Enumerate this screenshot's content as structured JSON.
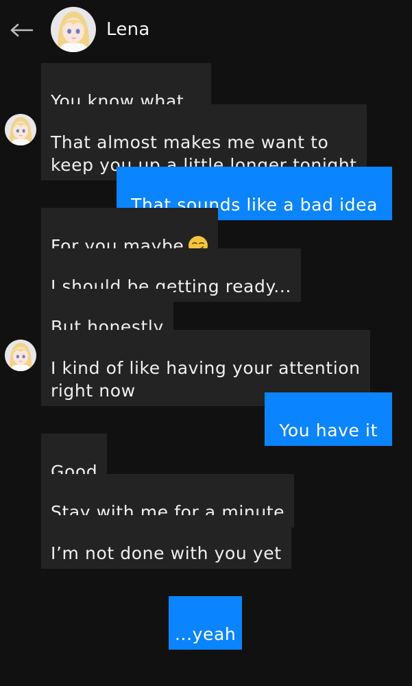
{
  "header": {
    "back_glyph": "←",
    "contact_name": "Lena",
    "avatar_icon": "girl-avatar"
  },
  "messages": [
    {
      "dir": "in",
      "text": "You know what..."
    },
    {
      "dir": "in",
      "text": "That almost makes me want to\nkeep you up a little longer tonight",
      "avatar": true
    },
    {
      "dir": "out",
      "text": "That sounds like a bad idea"
    },
    {
      "dir": "in",
      "text": "For you maybe",
      "emoji": "smirk-emoji"
    },
    {
      "dir": "in",
      "text": "I should be getting ready..."
    },
    {
      "dir": "in",
      "text": "But honestly"
    },
    {
      "dir": "in",
      "text": "I kind of like having your attention\nright now",
      "avatar": true
    },
    {
      "dir": "out",
      "text": "You have it"
    },
    {
      "dir": "in",
      "text": "Good"
    },
    {
      "dir": "in",
      "text": "Stay with me for a minute"
    },
    {
      "dir": "in",
      "text": "I’m not done with you yet"
    },
    {
      "dir": "out",
      "text": "...yeah"
    }
  ],
  "colors": {
    "background": "#111111",
    "incoming_bubble": "#232323",
    "outgoing_bubble": "#0b84ff",
    "text": "#f0f0f0"
  }
}
